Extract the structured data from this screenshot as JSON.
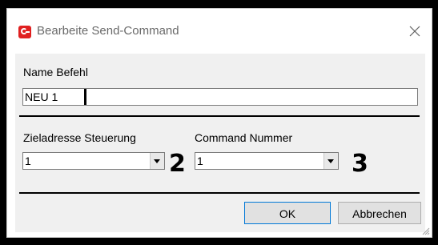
{
  "window": {
    "title": "Bearbeite Send-Command",
    "icon": "app-logo-icon",
    "accent": "#e02020"
  },
  "form": {
    "name_label": "Name Befehl",
    "name_value": "NEU 1",
    "target_label": "Zieladresse Steuerung",
    "target_value": "1",
    "command_label": "Command Nummer",
    "command_value": "1"
  },
  "annotations": {
    "target_marker": "2",
    "command_marker": "3"
  },
  "buttons": {
    "ok": "OK",
    "cancel": "Abbrechen"
  }
}
